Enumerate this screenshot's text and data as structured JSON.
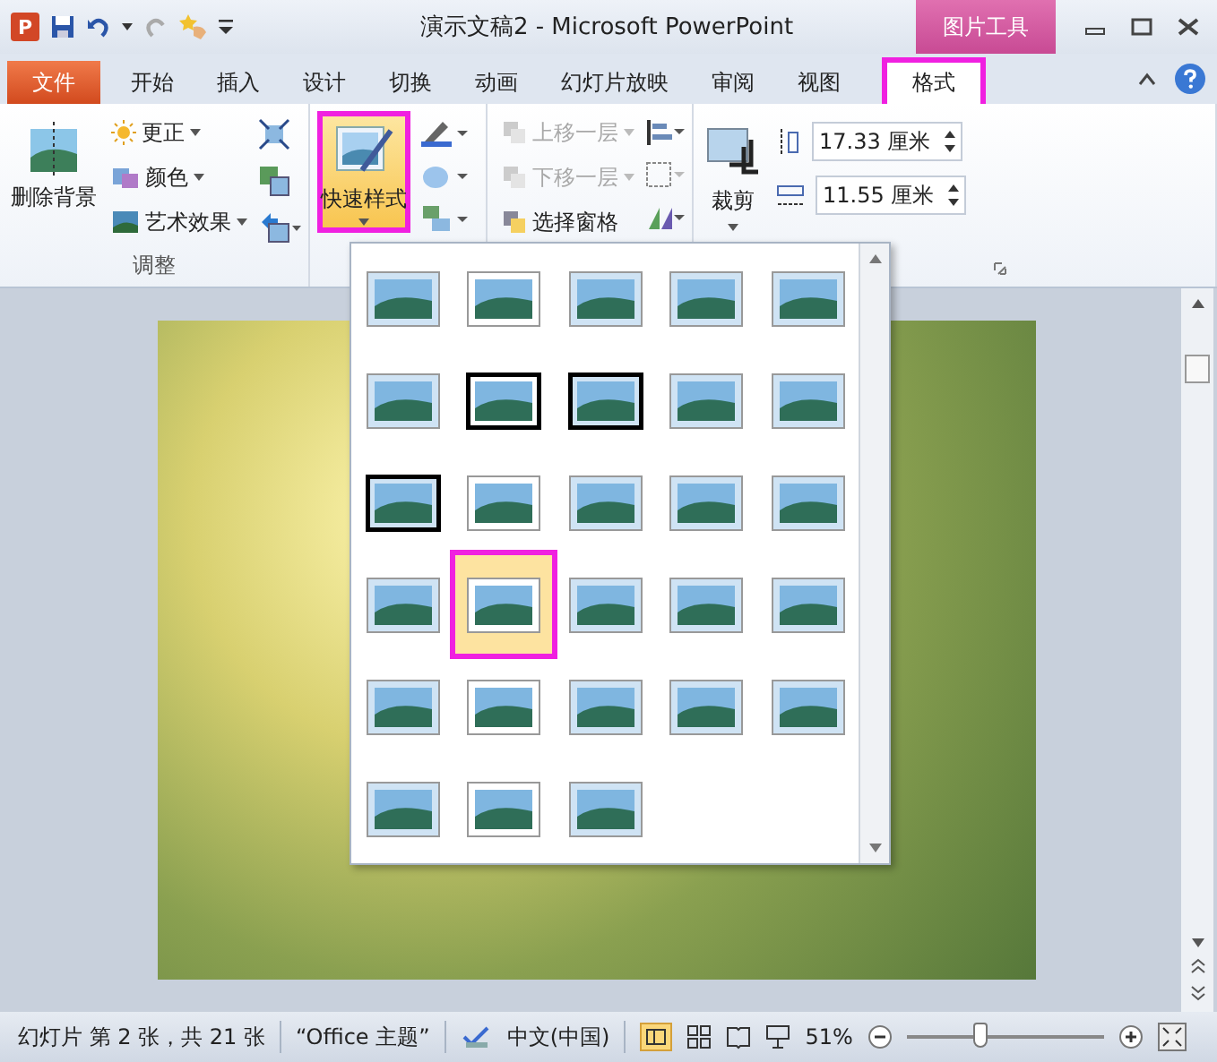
{
  "window": {
    "app_logo": "P",
    "title": "演示文稿2  -  Microsoft PowerPoint",
    "context_tab_group": "图片工具"
  },
  "tabs": [
    {
      "label": "文件",
      "kind": "file",
      "selected": false
    },
    {
      "label": "开始",
      "kind": "normal",
      "selected": false
    },
    {
      "label": "插入",
      "kind": "normal",
      "selected": false
    },
    {
      "label": "设计",
      "kind": "normal",
      "selected": false
    },
    {
      "label": "切换",
      "kind": "normal",
      "selected": false
    },
    {
      "label": "动画",
      "kind": "normal",
      "selected": false
    },
    {
      "label": "幻灯片放映",
      "kind": "normal",
      "selected": false
    },
    {
      "label": "审阅",
      "kind": "normal",
      "selected": false
    },
    {
      "label": "视图",
      "kind": "normal",
      "selected": false
    },
    {
      "label": "格式",
      "kind": "context",
      "selected": true
    }
  ],
  "ribbon": {
    "remove_background": "删除背景",
    "adjust_items": [
      {
        "label": "更正"
      },
      {
        "label": "颜色"
      },
      {
        "label": "艺术效果"
      }
    ],
    "adjust_group": "调整",
    "quick_styles": {
      "label": "快速样式",
      "pressed": true
    },
    "arrange_items": [
      {
        "label": "上移一层",
        "disabled": true
      },
      {
        "label": "下移一层",
        "disabled": true
      },
      {
        "label": "选择窗格",
        "disabled": false
      }
    ],
    "crop": "裁剪",
    "height": {
      "value": "17.33 厘米"
    },
    "width": {
      "value": "11.55 厘米"
    }
  },
  "gallery": {
    "styles": [
      {
        "selected": false
      },
      {
        "selected": false
      },
      {
        "selected": false
      },
      {
        "selected": false
      },
      {
        "selected": false
      },
      {
        "selected": false
      },
      {
        "selected": false
      },
      {
        "selected": false
      },
      {
        "selected": false
      },
      {
        "selected": false
      },
      {
        "selected": false
      },
      {
        "selected": false
      },
      {
        "selected": false
      },
      {
        "selected": false
      },
      {
        "selected": false
      },
      {
        "selected": false
      },
      {
        "selected": true
      },
      {
        "selected": false
      },
      {
        "selected": false
      },
      {
        "selected": false
      },
      {
        "selected": false
      },
      {
        "selected": false
      },
      {
        "selected": false
      },
      {
        "selected": false
      },
      {
        "selected": false
      },
      {
        "selected": false
      },
      {
        "selected": false
      },
      {
        "selected": false
      }
    ]
  },
  "status_bar": {
    "slide": "幻灯片 第 2 张，共 21 张",
    "theme": "“Office 主题”",
    "language": "中文(中国)",
    "zoom": "51%",
    "zoom_slider": {
      "level": 0.37
    }
  }
}
